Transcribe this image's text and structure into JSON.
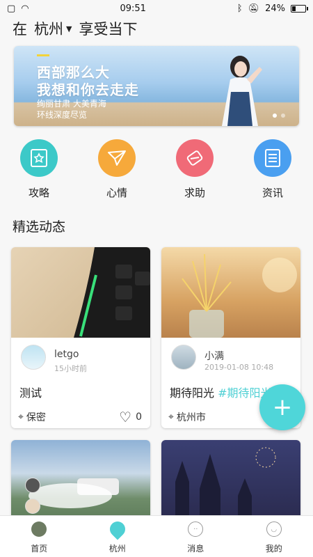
{
  "status": {
    "time": "09:51",
    "battery": "24%",
    "battery_level": 0.24
  },
  "header": {
    "prefix": "在",
    "city": "杭州",
    "slogan": "享受当下"
  },
  "banner": {
    "line1": "西部那么大",
    "line2": "我想和你去走走",
    "line3": "绚丽甘肃 大美青海",
    "line4": "环线深度尽览"
  },
  "quick": [
    {
      "label": "攻略",
      "icon": "guide-icon",
      "color": "#3cc9c8"
    },
    {
      "label": "心情",
      "icon": "paper-plane-icon",
      "color": "#f6a93b"
    },
    {
      "label": "求助",
      "icon": "handshake-icon",
      "color": "#f06a77"
    },
    {
      "label": "资讯",
      "icon": "news-icon",
      "color": "#4a9ff0"
    }
  ],
  "section_title": "精选动态",
  "cards": [
    {
      "user": "letgo",
      "time": "15小时前",
      "text": "测试",
      "tag": "",
      "location": "保密",
      "likes": "0"
    },
    {
      "user": "小满",
      "time": "2019-01-08 10:48",
      "text": "期待阳光 ",
      "tag": "#期待阳光",
      "location": "杭州市"
    }
  ],
  "fab": {
    "label": "+"
  },
  "tabs": [
    {
      "label": "首页",
      "icon": "home-avatar-icon"
    },
    {
      "label": "杭州",
      "icon": "location-pin-icon",
      "color": "#4fd0d4"
    },
    {
      "label": "消息",
      "icon": "message-icon"
    },
    {
      "label": "我的",
      "icon": "profile-icon"
    }
  ]
}
